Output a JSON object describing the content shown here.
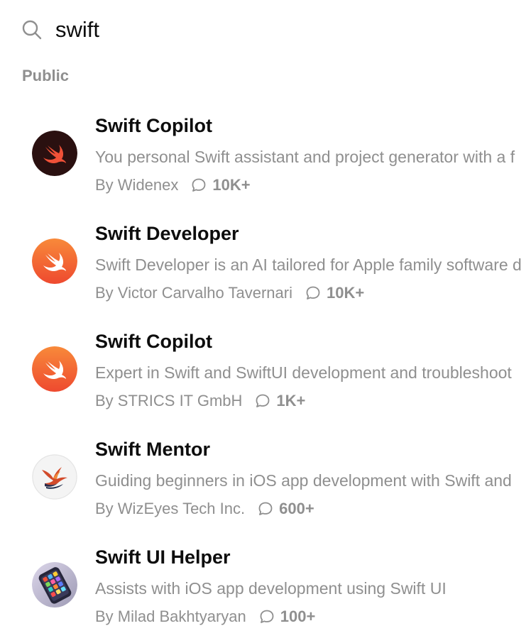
{
  "search": {
    "icon": "search-icon",
    "value": "swift"
  },
  "section": {
    "label": "Public"
  },
  "results": [
    {
      "title": "Swift Copilot",
      "description": "You personal Swift assistant and project generator with a f",
      "author": "By Widenex",
      "count": "10K+",
      "avatar": "swift-logo-dark",
      "avatar_bg": "#2a1010",
      "avatar_fg": "#f05138"
    },
    {
      "title": "Swift Developer",
      "description": "Swift Developer is an AI tailored for Apple family software d",
      "author": "By Victor Carvalho Tavernari",
      "count": "10K+",
      "avatar": "swift-logo-orange",
      "avatar_bg": "#f05138",
      "avatar_fg": "#ffffff"
    },
    {
      "title": "Swift Copilot",
      "description": "Expert in Swift and SwiftUI development and troubleshoot",
      "author": "By STRICS IT GmbH",
      "count": "1K+",
      "avatar": "swift-logo-orange",
      "avatar_bg": "#f05138",
      "avatar_fg": "#ffffff"
    },
    {
      "title": "Swift Mentor",
      "description": "Guiding beginners in iOS app development with Swift and",
      "author": "By WizEyes Tech Inc.",
      "count": "600+",
      "avatar": "swift-bird-illustration",
      "avatar_bg": "#f4f4f4",
      "avatar_fg": "#d24a2a"
    },
    {
      "title": "Swift UI Helper",
      "description": "Assists with iOS app development using Swift UI",
      "author": "By Milad Bakhtyaryan",
      "count": "100+",
      "avatar": "phone-app-grid",
      "avatar_bg": "#c9c6d8",
      "avatar_fg": "#2c2c3c"
    }
  ],
  "icons": {
    "chat": "chat-bubble-icon"
  }
}
